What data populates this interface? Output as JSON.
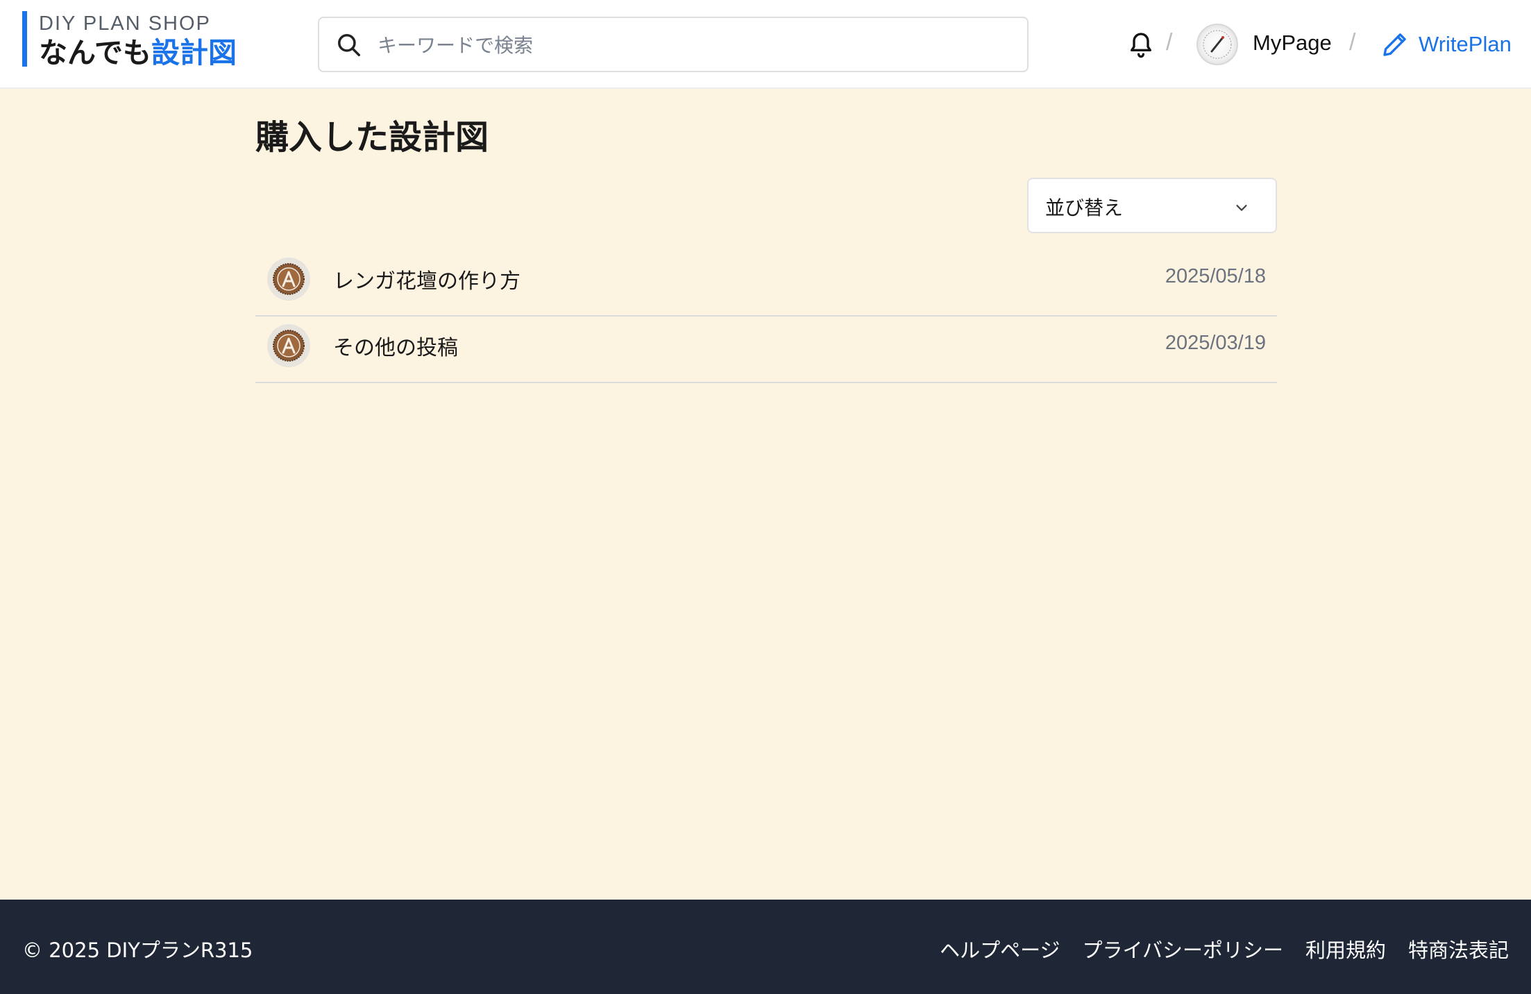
{
  "header": {
    "brand_small": "DIY PLAN SHOP",
    "brand_title_plain": "なんでも",
    "brand_title_accent": "設計図",
    "search_placeholder": "キーワードで検索",
    "separator": "/",
    "mypage_label": "MyPage",
    "writeplan_label": "WritePlan",
    "icons": [
      "search-icon",
      "bell-icon",
      "pencil-icon"
    ]
  },
  "main": {
    "title": "購入した設計図",
    "sort_label": "並び替え",
    "items": [
      {
        "title": "レンガ花壇の作り方",
        "date": "2025/05/18",
        "icon": "user-avatar-a"
      },
      {
        "title": "その他の投稿",
        "date": "2025/03/19",
        "icon": "user-avatar-a"
      }
    ]
  },
  "footer": {
    "copyright": "© 2025 DIYプランR315",
    "links": [
      "ヘルプページ",
      "プライバシーポリシー",
      "利用規約",
      "特商法表記"
    ]
  },
  "colors": {
    "accent": "#1a73e8",
    "page_background": "#fdf3e1",
    "footer_background": "#1f2736"
  }
}
